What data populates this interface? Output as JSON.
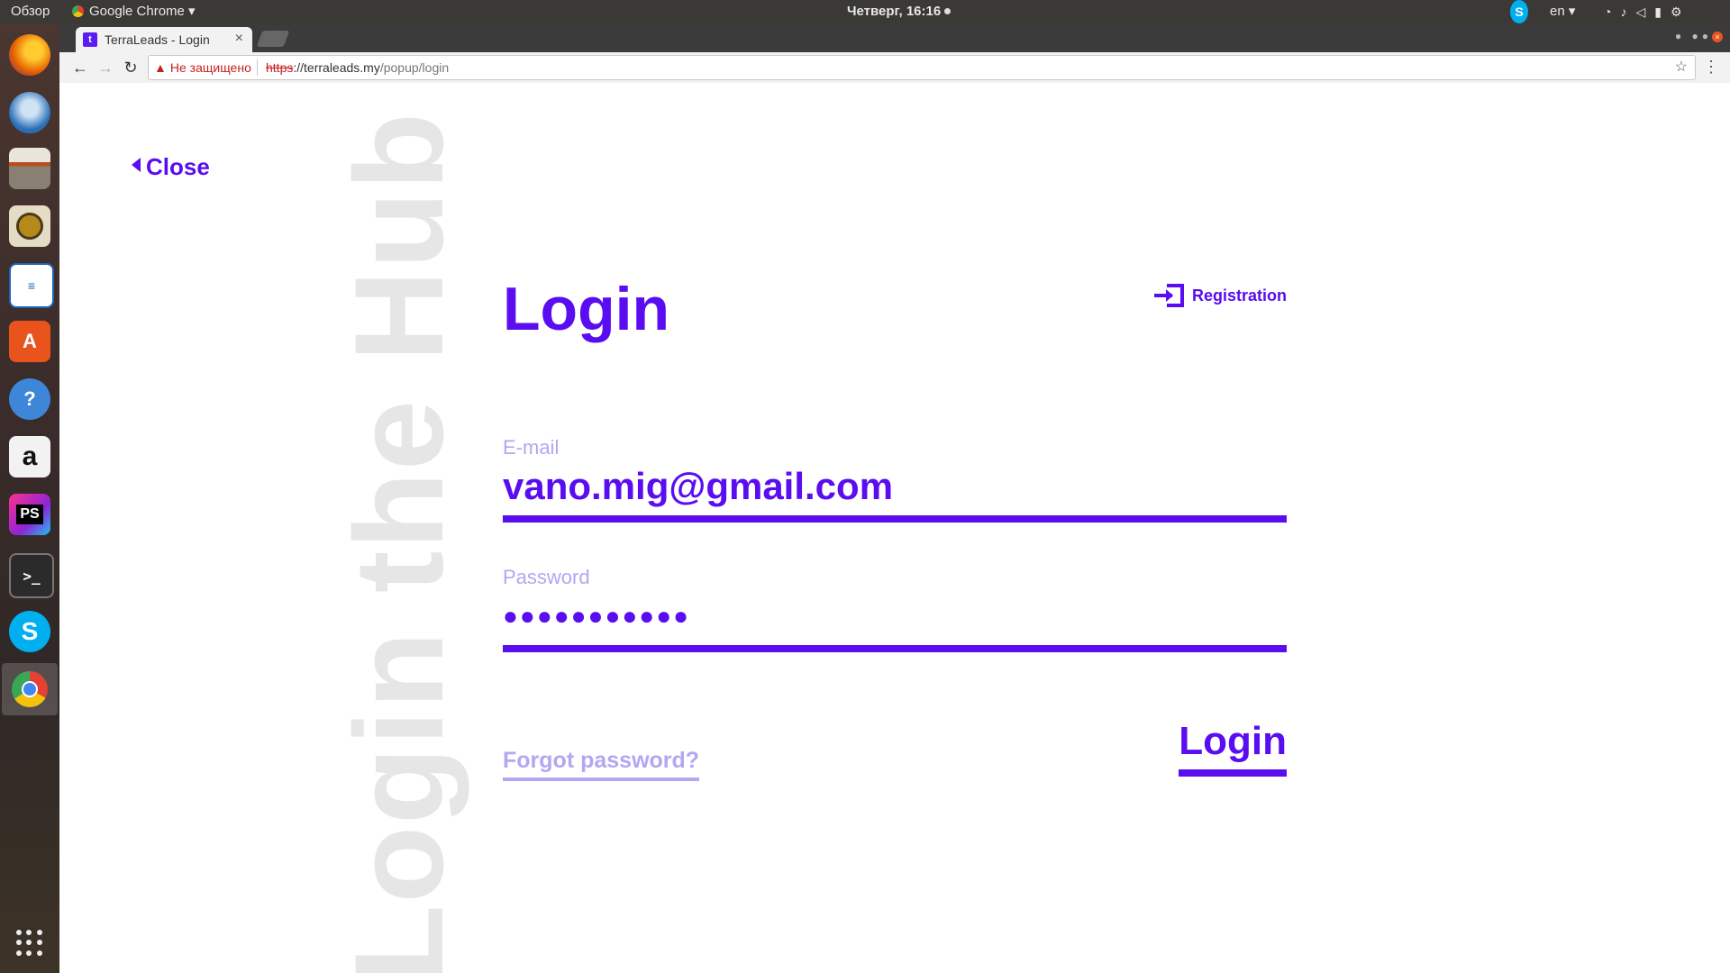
{
  "system_bar": {
    "activities": "Обзор",
    "app_name": "Google Chrome",
    "clock": "Четверг, 16:16",
    "language": "en"
  },
  "dock": {
    "apps": [
      {
        "name": "firefox",
        "color": "#e66000",
        "glyph": ""
      },
      {
        "name": "thunderbird",
        "color": "#2a6fb5",
        "glyph": ""
      },
      {
        "name": "files",
        "color": "#8a7f73",
        "glyph": ""
      },
      {
        "name": "rhythmbox",
        "color": "#d9c27a",
        "glyph": ""
      },
      {
        "name": "libreoffice-writer",
        "color": "#1e64b4",
        "glyph": ""
      },
      {
        "name": "software-center",
        "color": "#e9541d",
        "glyph": "A"
      },
      {
        "name": "help",
        "color": "#3e87d8",
        "glyph": "?"
      },
      {
        "name": "amazon",
        "color": "#e8e8e8",
        "glyph": "a"
      },
      {
        "name": "phpstorm",
        "color": "#8c24d6",
        "glyph": "PS"
      },
      {
        "name": "terminal",
        "color": "#2b2b2b",
        "glyph": ">_"
      },
      {
        "name": "skype",
        "color": "#00aff0",
        "glyph": "S"
      },
      {
        "name": "chrome",
        "color": "#ffffff",
        "glyph": ""
      }
    ]
  },
  "browser": {
    "tab_title": "TerraLeads - Login",
    "security_label": "Не защищено",
    "url_scheme": "https",
    "url_host": "://terraleads.my",
    "url_path": "/popup/login"
  },
  "page": {
    "watermark": "Login the Hub",
    "close_label": "Close",
    "title": "Login",
    "registration_label": "Registration",
    "email_label": "E-mail",
    "email_value": "vano.mig@gmail.com",
    "password_label": "Password",
    "password_value": "●●●●●●●●●●●",
    "forgot_label": "Forgot password?",
    "login_button": "Login"
  },
  "colors": {
    "accent": "#5a0df0",
    "accent_light": "#b3a6f3",
    "watermark": "#e6e6e6"
  }
}
